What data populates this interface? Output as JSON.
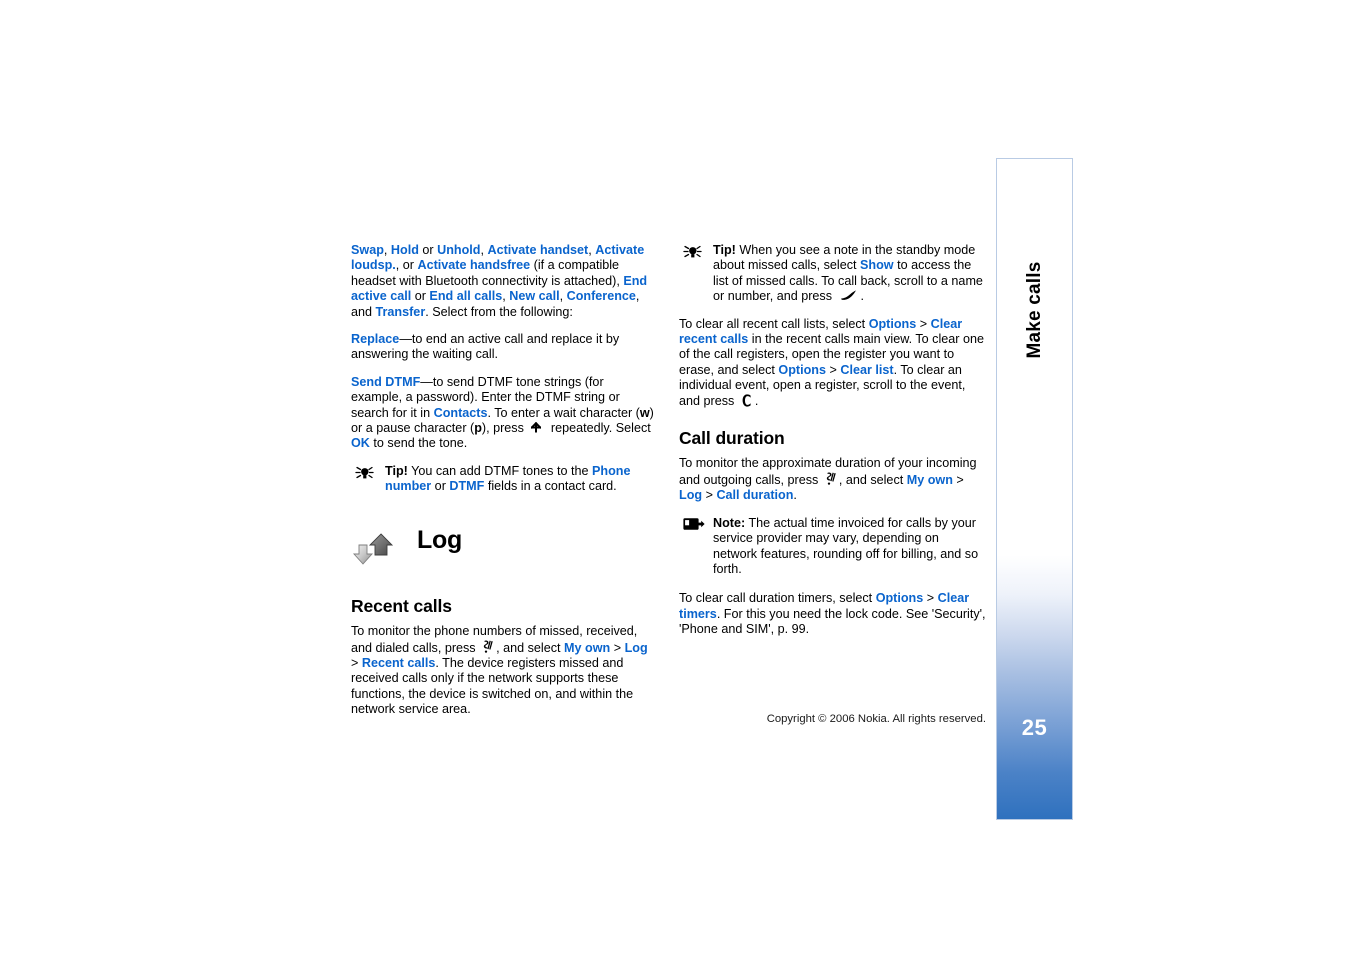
{
  "document": {
    "title": "Make calls",
    "page_number": "25",
    "copyright": "Copyright © 2006 Nokia. All rights reserved."
  },
  "left_column": {
    "paragraph_options": {
      "segments": [
        {
          "text": "Swap",
          "style": "link"
        },
        {
          "text": ", ",
          "style": "plain"
        },
        {
          "text": "Hold",
          "style": "link"
        },
        {
          "text": " or ",
          "style": "plain"
        },
        {
          "text": "Unhold",
          "style": "link"
        },
        {
          "text": ", ",
          "style": "plain"
        },
        {
          "text": "Activate handset",
          "style": "link"
        },
        {
          "text": ", ",
          "style": "plain"
        },
        {
          "text": "Activate loudsp.",
          "style": "link"
        },
        {
          "text": ", or ",
          "style": "plain"
        },
        {
          "text": "Activate handsfree",
          "style": "link"
        },
        {
          "text": " (if a compatible headset with Bluetooth connectivity is attached), ",
          "style": "plain"
        },
        {
          "text": "End active call",
          "style": "link"
        },
        {
          "text": " or ",
          "style": "plain"
        },
        {
          "text": "End all calls",
          "style": "link"
        },
        {
          "text": ", ",
          "style": "plain"
        },
        {
          "text": "New call",
          "style": "link"
        },
        {
          "text": ", ",
          "style": "plain"
        },
        {
          "text": "Conference",
          "style": "link"
        },
        {
          "text": ", and ",
          "style": "plain"
        },
        {
          "text": "Transfer",
          "style": "link"
        },
        {
          "text": ". Select from the following:",
          "style": "plain"
        }
      ]
    },
    "paragraph_replace": {
      "link": "Replace",
      "text": "—to end an active call and replace it by answering the waiting call."
    },
    "paragraph_send_dtmf": {
      "link": "Send DTMF",
      "text_1": "—to send DTMF tone strings (for example, a password). Enter the DTMF string or search for it in ",
      "link_2": "Contacts",
      "text_2": ". To enter a wait character (",
      "bold_w": "w",
      "text_3": ") or a pause character (",
      "bold_p": "p",
      "text_4": "), press ",
      "text_5": " repeatedly. Select ",
      "link_3": "OK",
      "text_6": " to send the tone."
    },
    "tip_dtmf": {
      "icon": "lightbulb-tip-icon",
      "label": "Tip!",
      "text_1": " You can add DTMF tones to the ",
      "link_1": "Phone number",
      "text_2": " or ",
      "link_2": "DTMF",
      "text_3": " fields in a contact card."
    },
    "chapter": {
      "icon": "log-arrows-icon",
      "title": "Log"
    },
    "heading_recent_calls": "Recent calls",
    "paragraph_recent_calls": {
      "text_1": "To monitor the phone numbers of missed, received, and dialed calls, press ",
      "text_2": ", and select ",
      "link_1": "My own",
      "sep_1": " > ",
      "link_2": "Log",
      "sep_2": " > ",
      "link_3": "Recent calls",
      "text_3": ". The device registers missed and received calls only if the network supports these functions, the device is switched on, and within the network service area."
    }
  },
  "right_column": {
    "tip_missed_calls": {
      "icon": "lightbulb-tip-icon",
      "label": "Tip!",
      "text_1": " When you see a note in the standby mode about missed calls, select ",
      "link_1": "Show",
      "text_2": " to access the list of missed calls. To call back, scroll to a name or number, and press ",
      "text_3": "."
    },
    "paragraph_clear_lists": {
      "text_1": "To clear all recent call lists, select ",
      "link_1": "Options",
      "sep_1": " > ",
      "link_2": "Clear recent calls",
      "text_2": " in the recent calls main view. To clear one of the call registers, open the register you want to erase, and select ",
      "link_3": "Options",
      "sep_2": " > ",
      "link_4": "Clear list",
      "text_3": ". To clear an individual event, open a register, scroll to the event, and press ",
      "text_4": "."
    },
    "heading_call_duration": "Call duration",
    "paragraph_call_duration": {
      "text_1": "To monitor the approximate duration of your incoming and outgoing calls, press ",
      "text_2": ", and select ",
      "link_1": "My own",
      "sep_1": " > ",
      "link_2": "Log",
      "sep_2": " > ",
      "link_3": "Call duration",
      "text_3": "."
    },
    "note_invoiced_time": {
      "icon": "note-arrow-icon",
      "label": "Note:",
      "text": " The actual time invoiced for calls by your service provider may vary, depending on network features, rounding off for billing, and so forth."
    },
    "paragraph_clear_timers": {
      "text_1": "To clear call duration timers, select ",
      "link_1": "Options",
      "sep_1": " > ",
      "link_2": "Clear timers",
      "text_2": ". For this you need the lock code. See 'Security', 'Phone and SIM', p. 99."
    }
  },
  "colors": {
    "link_blue": "#0a64cd",
    "tab_gradient_end": "#2f71be",
    "text_black": "#000000"
  }
}
